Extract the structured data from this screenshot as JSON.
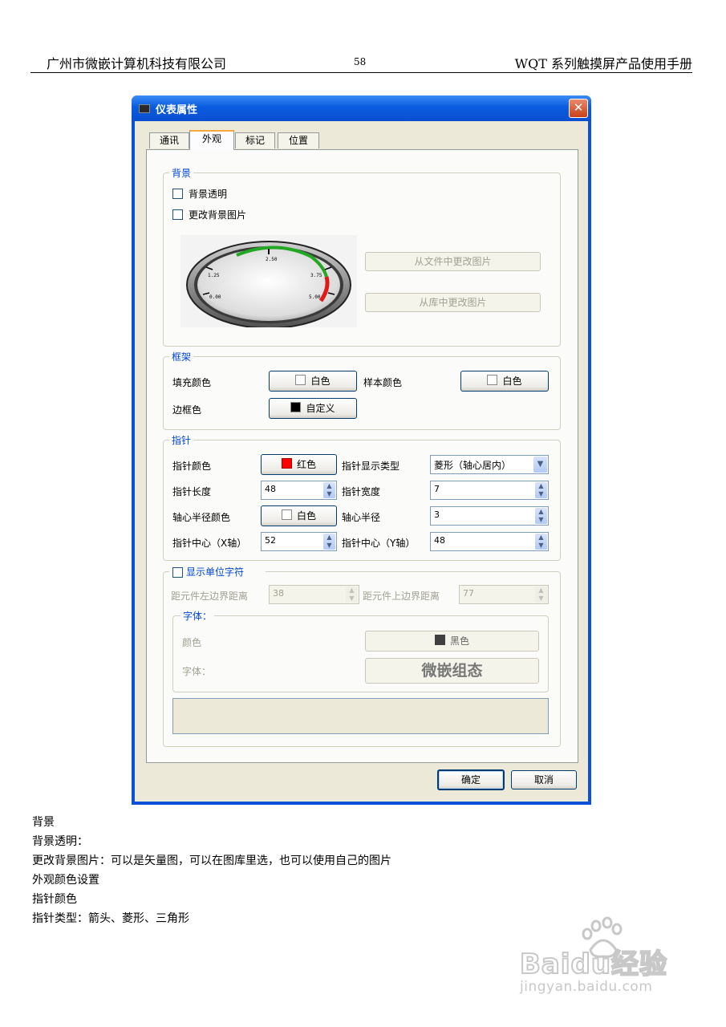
{
  "page_header": {
    "company": "广州市微嵌计算机科技有限公司",
    "page_number": "58",
    "manual_title": "WQT 系列触摸屏产品使用手册"
  },
  "dialog": {
    "title": "仪表属性",
    "tabs": [
      "通讯",
      "外观",
      "标记",
      "位置"
    ],
    "active_tab": "外观",
    "background_group": {
      "title": "背景",
      "transparent_label": "背景透明",
      "change_image_label": "更改背景图片",
      "from_file_button": "从文件中更改图片",
      "from_library_button": "从库中更改图片",
      "gauge_preview_labels": [
        "2.50",
        "1.25",
        "3.75",
        "0.00",
        "5.00"
      ]
    },
    "frame_group": {
      "title": "框架",
      "fill_color_label": "填充颜色",
      "fill_color_value": "白色",
      "sample_color_label": "样本颜色",
      "sample_color_value": "白色",
      "border_color_label": "边框色",
      "border_color_value": "自定义"
    },
    "needle_group": {
      "title": "指针",
      "needle_color_label": "指针颜色",
      "needle_color_value": "红色",
      "display_type_label": "指针显示类型",
      "display_type_value": "菱形（轴心居内）",
      "length_label": "指针长度",
      "length_value": "48",
      "width_label": "指针宽度",
      "width_value": "7",
      "hub_color_label": "轴心半径颜色",
      "hub_color_value": "白色",
      "hub_radius_label": "轴心半径",
      "hub_radius_value": "3",
      "center_x_label": "指针中心（X轴）",
      "center_x_value": "52",
      "center_y_label": "指针中心（Y轴）",
      "center_y_value": "48"
    },
    "unit_group": {
      "checkbox_label": "显示单位字符",
      "left_distance_label": "距元件左边界距离",
      "left_distance_value": "38",
      "top_distance_label": "距元件上边界距离",
      "top_distance_value": "77",
      "font_group": {
        "title": "字体：",
        "color_label": "颜色",
        "color_value": "黑色",
        "font_label": "字体：",
        "font_sample": "微嵌组态"
      }
    },
    "ok_button": "确定",
    "cancel_button": "取消"
  },
  "colors": {
    "title_bar": "#0a5be0",
    "needle_red": "#ff0000",
    "white": "#ffffff",
    "custom_black": "#000000",
    "font_black": "#404040",
    "gauge_arc_green": "#22a822",
    "gauge_arc_red": "#e01818"
  },
  "body_text": [
    "背景",
    "背景透明：",
    "更改背景图片：可以是矢量图，可以在图库里选，也可以使用自己的图片",
    "外观颜色设置",
    "指针颜色",
    "指针类型：箭头、菱形、三角形"
  ],
  "watermark": {
    "brand": "Baidu经验",
    "url": "jingyan.baidu.com"
  }
}
